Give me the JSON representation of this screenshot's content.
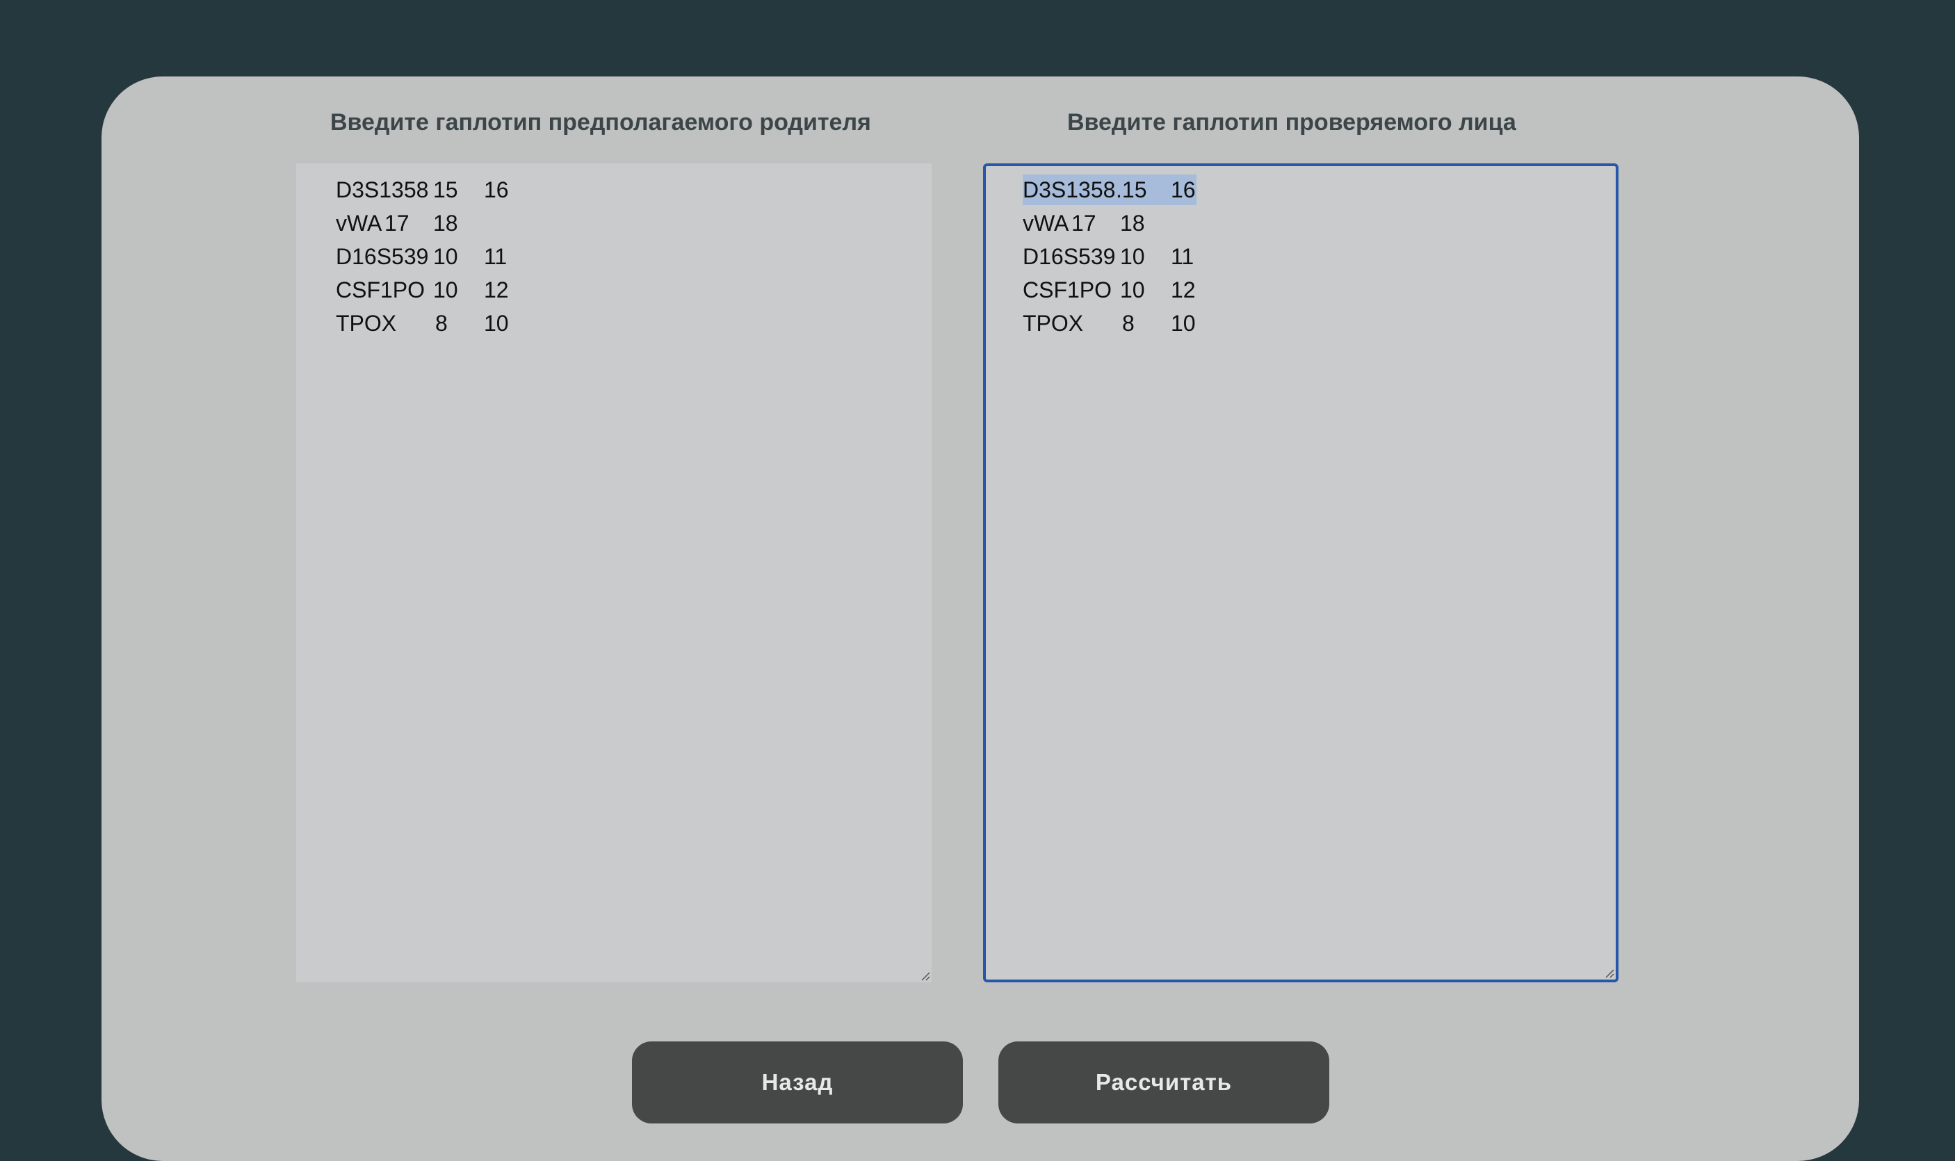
{
  "parent_panel": {
    "title": "Введите гаплотип предполагаемого родителя",
    "lines": [
      [
        "D3S1358",
        "15",
        "16"
      ],
      [
        "vWA",
        "17",
        "18"
      ],
      [
        "D16S539",
        "10",
        "11"
      ],
      [
        "CSF1PO",
        "10",
        "12"
      ],
      [
        "TPOX",
        "8",
        "10"
      ]
    ]
  },
  "subject_panel": {
    "title": "Введите гаплотип проверяемого лица",
    "lines": [
      [
        "D3S1358",
        ".15",
        "16"
      ],
      [
        "vWA",
        "17",
        "18"
      ],
      [
        "D16S539",
        "10",
        "11"
      ],
      [
        "CSF1PO",
        "10",
        "12"
      ],
      [
        "TPOX",
        "8",
        "10"
      ]
    ],
    "focused": true,
    "selected_line": "D3S1358 .15 16"
  },
  "buttons": {
    "back_label": "Назад",
    "calculate_label": "Рассчитать"
  },
  "colors": {
    "background": "#25383e",
    "card": "#c0c2c1",
    "textarea": "#c9cbcc",
    "focus_border": "#2856a8",
    "selection": "#a6bcda",
    "button": "#464847"
  },
  "icons": {
    "resize_grip": "resize-grip-icon"
  }
}
